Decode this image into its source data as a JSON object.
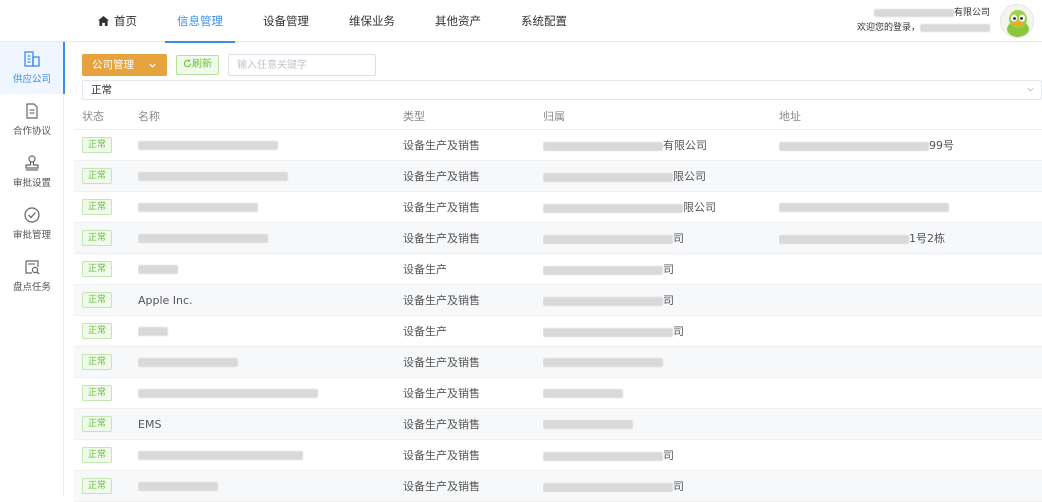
{
  "nav": {
    "home": "首页",
    "items": [
      "信息管理",
      "设备管理",
      "维保业务",
      "其他资产",
      "系统配置"
    ],
    "active_index": 0
  },
  "user": {
    "company_suffix": "有限公司",
    "welcome_prefix": "欢迎您的登录，"
  },
  "sidebar": {
    "items": [
      {
        "label": "供应公司",
        "icon": "building-icon",
        "active": true
      },
      {
        "label": "合作协议",
        "icon": "document-icon",
        "active": false
      },
      {
        "label": "审批设置",
        "icon": "stamp-icon",
        "active": false
      },
      {
        "label": "审批管理",
        "icon": "check-circle-icon",
        "active": false
      },
      {
        "label": "盘点任务",
        "icon": "inventory-search-icon",
        "active": false
      }
    ]
  },
  "toolbar": {
    "company_button": "公司管理",
    "refresh_button": "刷新",
    "search_placeholder": "输入任意关键字"
  },
  "filter": {
    "status_value": "正常"
  },
  "table": {
    "columns": [
      "状态",
      "名称",
      "类型",
      "归属",
      "地址"
    ],
    "rows": [
      {
        "status": "正常",
        "name": "",
        "type": "设备生产及销售",
        "owner": "有限公司",
        "address": "99号"
      },
      {
        "status": "正常",
        "name": "",
        "type": "设备生产及销售",
        "owner": "限公司",
        "address": ""
      },
      {
        "status": "正常",
        "name": "",
        "type": "设备生产及销售",
        "owner": "限公司",
        "address": ""
      },
      {
        "status": "正常",
        "name": "",
        "type": "设备生产及销售",
        "owner": "司",
        "address": "1号2栋"
      },
      {
        "status": "正常",
        "name": "",
        "type": "设备生产",
        "owner": "司",
        "address": ""
      },
      {
        "status": "正常",
        "name": "Apple Inc.",
        "type": "设备生产及销售",
        "owner": "司",
        "address": ""
      },
      {
        "status": "正常",
        "name": "",
        "type": "设备生产",
        "owner": "司",
        "address": ""
      },
      {
        "status": "正常",
        "name": "",
        "type": "设备生产及销售",
        "owner": "",
        "address": ""
      },
      {
        "status": "正常",
        "name": "",
        "type": "设备生产及销售",
        "owner": "",
        "address": ""
      },
      {
        "status": "正常",
        "name": "EMS",
        "type": "设备生产及销售",
        "owner": "",
        "address": ""
      },
      {
        "status": "正常",
        "name": "",
        "type": "设备生产及销售",
        "owner": "司",
        "address": ""
      },
      {
        "status": "正常",
        "name": "",
        "type": "设备生产及销售",
        "owner": "司",
        "address": ""
      }
    ]
  }
}
